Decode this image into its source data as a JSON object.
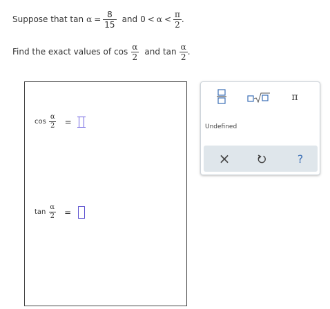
{
  "problem": {
    "line1_prefix": "Suppose that tan",
    "alpha": "α",
    "equals": "=",
    "tan_numerator": "8",
    "tan_denominator": "15",
    "and": "and",
    "range_lower": "0",
    "less_than": "<",
    "range_numerator": "π",
    "range_denominator": "2",
    "period": ".",
    "line2_prefix": "Find the exact values of",
    "cos_fn": "cos",
    "tan_fn": "tan",
    "half_numerator": "α",
    "half_denominator": "2"
  },
  "answers": [
    {
      "fn": "cos",
      "numerator": "α",
      "denominator": "2",
      "equals": "=",
      "value": ""
    },
    {
      "fn": "tan",
      "numerator": "α",
      "denominator": "2",
      "equals": "=",
      "value": ""
    }
  ],
  "toolbar": {
    "pi_symbol": "π",
    "undefined_label": "Undefined",
    "clear_symbol": "×",
    "help_symbol": "?"
  },
  "colors": {
    "accent": "#3b6fb6",
    "input_border": "#5a4fcf",
    "action_bar": "#dfe6eb"
  },
  "icons": [
    "fraction-icon",
    "square-root-icon",
    "pi-icon",
    "clear-icon",
    "undo-icon",
    "help-icon"
  ]
}
